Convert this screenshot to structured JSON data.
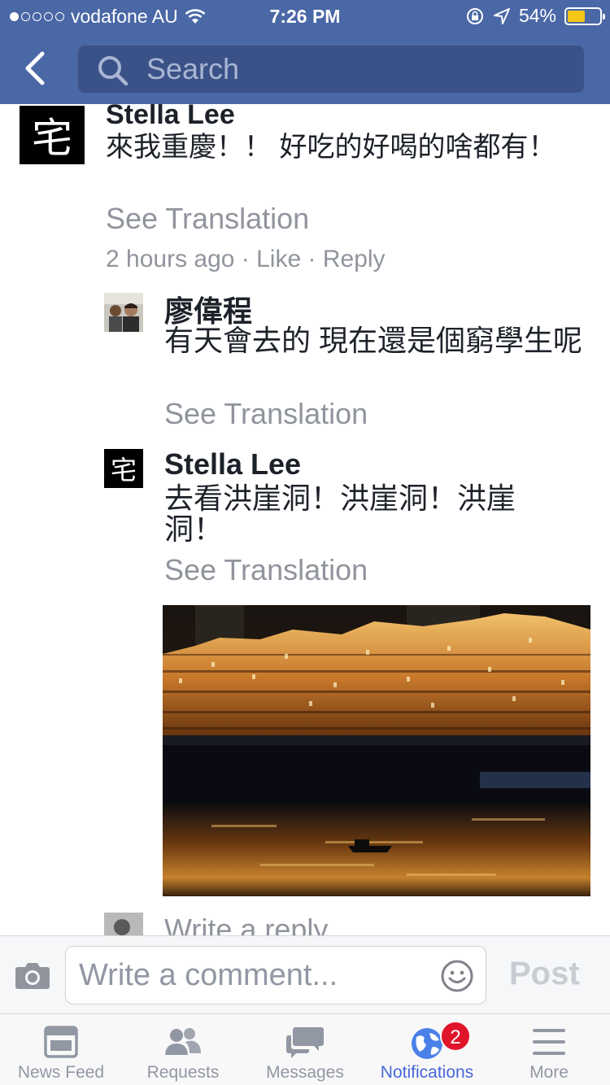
{
  "status_bar": {
    "carrier": "vodafone AU",
    "time": "7:26 PM",
    "battery": "54%",
    "battery_level": 0.54,
    "signal_bars_filled": 1,
    "signal_bars_total": 5
  },
  "nav": {
    "back_icon": "chevron-left-icon",
    "search_placeholder": "Search"
  },
  "comments": [
    {
      "author": "Stella Lee",
      "avatar_char": "宅",
      "text": "來我重慶！！ 好吃的好喝的啥都有！",
      "see_translation": "See Translation",
      "time": "2 hours ago",
      "like": "Like",
      "reply": "Reply",
      "replies": [
        {
          "author": "廖偉程",
          "text": "有天會去的 現在還是個窮學生呢",
          "see_translation": "See Translation"
        },
        {
          "author": "Stella Lee",
          "avatar_char": "宅",
          "text": "去看洪崖洞！洪崖洞！洪崖洞！",
          "see_translation": "See Translation",
          "has_photo": true
        }
      ],
      "reply_placeholder": "Write a reply..."
    }
  ],
  "composer": {
    "placeholder": "Write a comment...",
    "post_label": "Post",
    "camera_icon": "camera-icon",
    "emoji_icon": "smiley-icon"
  },
  "tabs": [
    {
      "label": "News Feed",
      "icon": "news-feed-icon",
      "active": false
    },
    {
      "label": "Requests",
      "icon": "friend-requests-icon",
      "active": false
    },
    {
      "label": "Messages",
      "icon": "messages-icon",
      "active": false
    },
    {
      "label": "Notifications",
      "icon": "globe-icon",
      "active": true,
      "badge": "2"
    },
    {
      "label": "More",
      "icon": "menu-icon",
      "active": false
    }
  ],
  "colors": {
    "nav_blue": "#4a67a6",
    "search_bg": "#3b5288",
    "active_tab": "#4a67d9",
    "badge_red": "#e0142a",
    "secondary_text": "#90949c"
  }
}
